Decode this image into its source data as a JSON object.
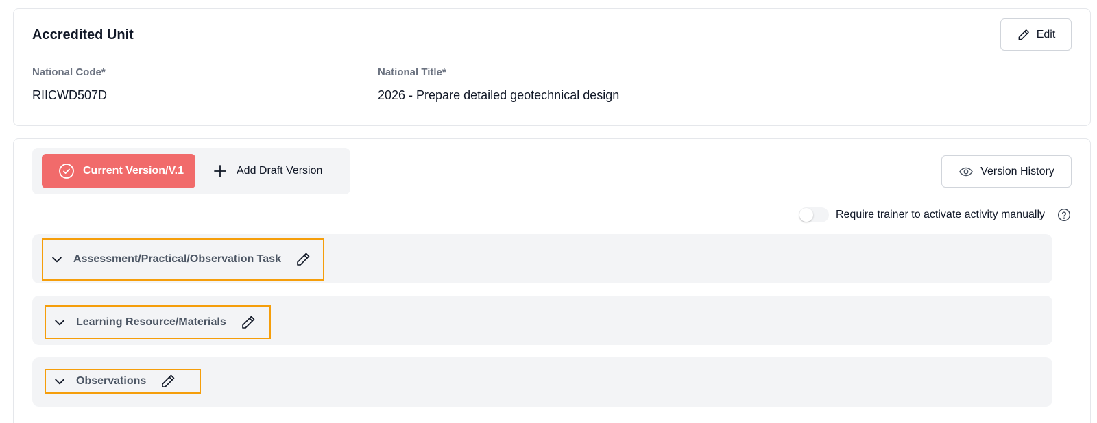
{
  "unit": {
    "title": "Accredited Unit",
    "edit_label": "Edit",
    "national_code_label": "National Code*",
    "national_code_value": "RIICWD507D",
    "national_title_label": "National Title*",
    "national_title_value": "2026 - Prepare detailed geotechnical design"
  },
  "versions": {
    "current_label": "Current Version/V.1",
    "add_draft_label": "Add Draft Version",
    "history_label": "Version History",
    "accent_color": "#f16b6b"
  },
  "toggle": {
    "label": "Require trainer to activate activity manually",
    "enabled": false
  },
  "sections": [
    {
      "title": "Assessment/Practical/Observation Task",
      "expanded": false
    },
    {
      "title": "Learning Resource/Materials",
      "expanded": false
    },
    {
      "title": "Observations",
      "expanded": false
    }
  ],
  "icons": {
    "edit": "pencil-icon",
    "current": "check-circle-icon",
    "add": "plus-icon",
    "history": "eye-icon",
    "help": "question-circle-icon",
    "section": "chevron-down-icon"
  }
}
